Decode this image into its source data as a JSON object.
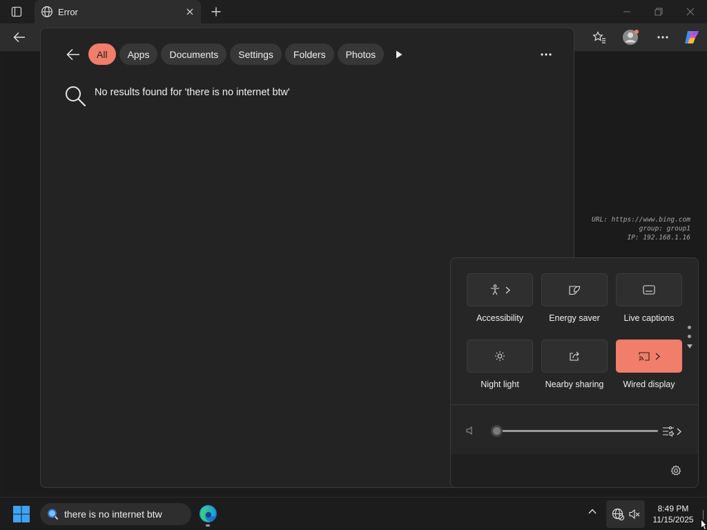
{
  "browser": {
    "tab_title": "Error",
    "nav_buttons": [
      "favorites-icon",
      "profile-icon",
      "more-icon",
      "copilot-icon"
    ]
  },
  "info_overlay": {
    "url_line": "URL: https://www.bing.com",
    "group_line": "group: group1",
    "ip_line": "IP: 192.168.1.16"
  },
  "search": {
    "chips": [
      {
        "label": "All",
        "active": true
      },
      {
        "label": "Apps",
        "active": false
      },
      {
        "label": "Documents",
        "active": false
      },
      {
        "label": "Settings",
        "active": false
      },
      {
        "label": "Folders",
        "active": false
      },
      {
        "label": "Photos",
        "active": false
      }
    ],
    "no_results": "No results found for 'there is no internet btw'"
  },
  "quick_settings": {
    "tiles": [
      {
        "label": "Accessibility",
        "icon": "accessibility-icon",
        "chevron": true,
        "on": false
      },
      {
        "label": "Energy saver",
        "icon": "energy-saver-icon",
        "chevron": false,
        "on": false
      },
      {
        "label": "Live captions",
        "icon": "live-captions-icon",
        "chevron": false,
        "on": false
      },
      {
        "label": "Night light",
        "icon": "night-light-icon",
        "chevron": false,
        "on": false
      },
      {
        "label": "Nearby sharing",
        "icon": "nearby-sharing-icon",
        "chevron": false,
        "on": false
      },
      {
        "label": "Wired display",
        "icon": "cast-icon",
        "chevron": true,
        "on": true
      }
    ],
    "volume_level": 0,
    "accent_color": "#f07e6a"
  },
  "taskbar": {
    "search_text": "there is no internet btw",
    "time": "8:49 PM",
    "date": "11/15/2025"
  }
}
